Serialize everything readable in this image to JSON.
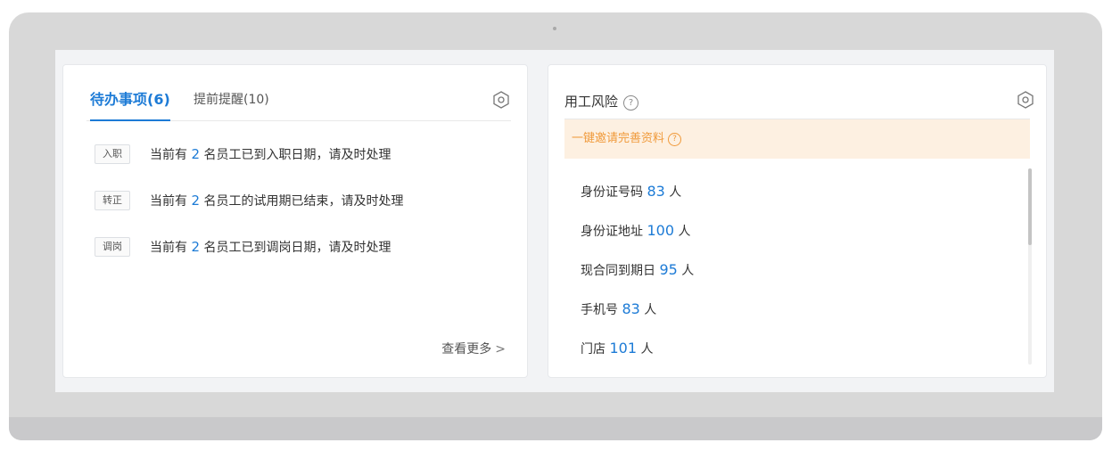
{
  "todo": {
    "active_tab": "待办事项(6)",
    "reminder_tab": "提前提醒(10)",
    "items": [
      {
        "tag": "入职",
        "prefix": "当前有 ",
        "count": "2",
        "suffix": " 名员工已到入职日期，请及时处理"
      },
      {
        "tag": "转正",
        "prefix": "当前有 ",
        "count": "2",
        "suffix": " 名员工的试用期已结束，请及时处理"
      },
      {
        "tag": "调岗",
        "prefix": "当前有 ",
        "count": "2",
        "suffix": " 名员工已到调岗日期，请及时处理"
      }
    ],
    "see_more": "查看更多",
    "see_more_icon": "chevron-right-icon"
  },
  "risk": {
    "title": "用工风险",
    "help_symbol": "?",
    "invite_label": "一键邀请完善资料",
    "items": [
      {
        "label": "身份证号码 ",
        "count": "83",
        "unit": " 人"
      },
      {
        "label": "身份证地址 ",
        "count": "100",
        "unit": " 人"
      },
      {
        "label": "现合同到期日 ",
        "count": "95",
        "unit": " 人"
      },
      {
        "label": "手机号 ",
        "count": "83",
        "unit": " 人"
      },
      {
        "label": "门店 ",
        "count": "101",
        "unit": " 人"
      }
    ]
  },
  "colors": {
    "accent": "#1d7bd6",
    "invite_bg": "#fdf0e1",
    "invite_text": "#f09a3b",
    "frame": "#d8d8d8"
  },
  "icons": {
    "settings": "hexagon-gear-icon",
    "help": "question-circle-icon"
  }
}
